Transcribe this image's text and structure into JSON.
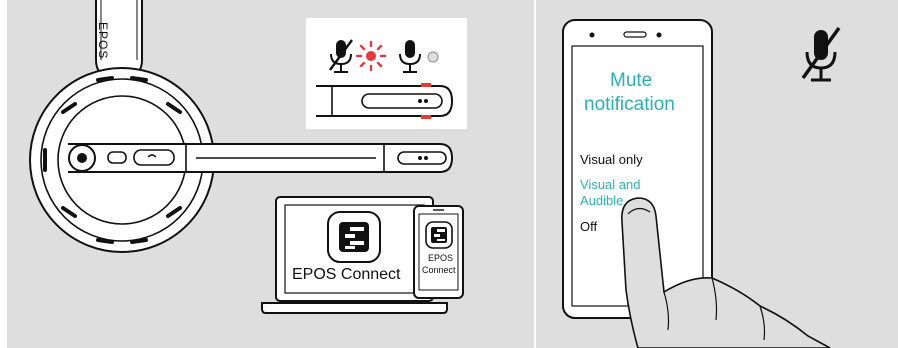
{
  "headset": {
    "brand_label": "EPOS",
    "indicator_labels": [
      "mic-muted-icon",
      "red-blink-led-icon",
      "mic-icon",
      "led-off-icon"
    ]
  },
  "laptop": {
    "app_label": "EPOS Connect",
    "app_icon": "epos-connect-app-icon"
  },
  "tablet": {
    "app_label_line1": "EPOS",
    "app_label_line2": "Connect"
  },
  "phone": {
    "title_line1": "Mute",
    "title_line2": "notification",
    "options": [
      {
        "label": "Visual only",
        "selected": false
      },
      {
        "label_line1": "Visual and",
        "label_line2": "Audible",
        "selected": true
      },
      {
        "label": "Off",
        "selected": false
      }
    ]
  },
  "corner_icon": "mic-muted-icon",
  "colors": {
    "accent": "#2bb0b4",
    "led_red": "#e8383a",
    "background": "#dedede"
  }
}
